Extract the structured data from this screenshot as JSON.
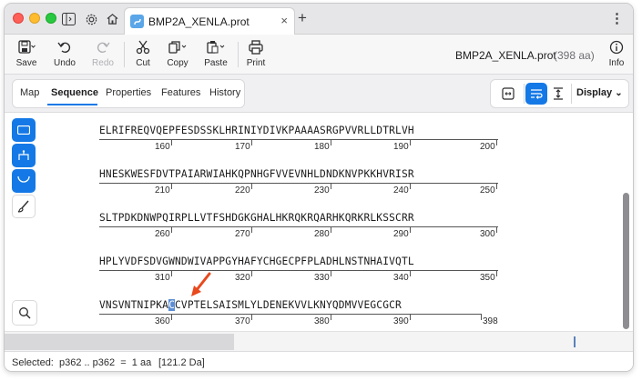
{
  "window": {
    "tab_title": "BMP2A_XENLA.prot",
    "new_tab": "+",
    "close_tab": "×",
    "more_menu": "⋮"
  },
  "toolbar": {
    "save": "Save",
    "undo": "Undo",
    "redo": "Redo",
    "cut": "Cut",
    "copy": "Copy",
    "paste": "Paste",
    "print": "Print",
    "info": "Info",
    "doc_title": "BMP2A_XENLA.prot",
    "doc_length": "(398 aa)"
  },
  "view_tabs": {
    "items": [
      "Map",
      "Sequence",
      "Properties",
      "Features",
      "History"
    ],
    "active": "Sequence",
    "display": "Display"
  },
  "sequence": {
    "lines": [
      {
        "text": "ELRIFREQVQEPFESDSSKLHRINIYDIVKPAAAASRGPVVRLLDTRLVH",
        "ticks": [
          "160",
          "170",
          "180",
          "190",
          "200"
        ]
      },
      {
        "text": "HNESKWESFDVTPAIARWIAHKQPNHGFVVEVNHLDNDKNVPKKHVRISR",
        "ticks": [
          "210",
          "220",
          "230",
          "240",
          "250"
        ]
      },
      {
        "text": "SLTPDKDNWPQIRPLLVTFSHDGKGHALHKRQKRQARHKQRKRLKSSCRR",
        "ticks": [
          "260",
          "270",
          "280",
          "290",
          "300"
        ]
      },
      {
        "text": "HPLYVDFSDVGWNDWIVAPPGYHAFYCHGECPFPLADHLNSTNHAIVQTL",
        "ticks": [
          "310",
          "320",
          "330",
          "340",
          "350"
        ]
      },
      {
        "text_before": "VNSVNTNIPKA",
        "text_selected": "C",
        "text_after": "CVPTELSAISMLYLDENEKVVLKNYQDMVVEGCGCR",
        "ticks": [
          "360",
          "370",
          "380",
          "390"
        ],
        "end_label": "398"
      }
    ]
  },
  "status": {
    "selection": "Selected:  p362 .. p362  =  1 aa",
    "mass": "[121.2 Da]"
  },
  "colors": {
    "accent": "#1479e6",
    "selection": "#5d8ed4",
    "arrow": "#e8491d"
  }
}
